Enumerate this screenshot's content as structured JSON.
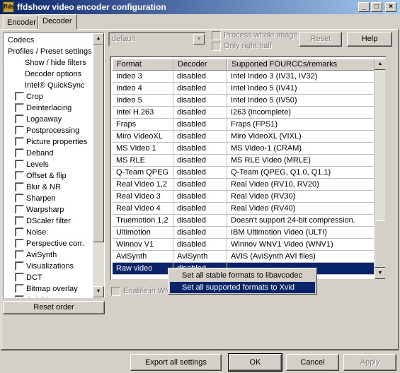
{
  "window": {
    "title": "ffdshow video encoder configuration",
    "min": "_",
    "max": "□",
    "close": "×",
    "app_icon": "ffds"
  },
  "tabs": [
    "Encoder",
    "Decoder"
  ],
  "tree": {
    "items": [
      {
        "label": "Codecs",
        "check": false,
        "indent": 0
      },
      {
        "label": "Profiles / Preset settings",
        "check": false,
        "indent": 0
      },
      {
        "label": "Show / hide filters",
        "check": false,
        "indent": 1
      },
      {
        "label": "Decoder options",
        "check": false,
        "indent": 1
      },
      {
        "label": "Intel® QuickSync",
        "check": false,
        "indent": 1
      },
      {
        "label": "Crop",
        "check": true
      },
      {
        "label": "Deinterlacing",
        "check": true
      },
      {
        "label": "Logoaway",
        "check": true
      },
      {
        "label": "Postprocessing",
        "check": true
      },
      {
        "label": "Picture properties",
        "check": true
      },
      {
        "label": "Deband",
        "check": true
      },
      {
        "label": "Levels",
        "check": true
      },
      {
        "label": "Offset & flip",
        "check": true
      },
      {
        "label": "Blur & NR",
        "check": true
      },
      {
        "label": "Sharpen",
        "check": true
      },
      {
        "label": "Warpsharp",
        "check": true
      },
      {
        "label": "DScaler filter",
        "check": true
      },
      {
        "label": "Noise",
        "check": true
      },
      {
        "label": "Perspective corr.",
        "check": true
      },
      {
        "label": "AviSynth",
        "check": true
      },
      {
        "label": "Visualizations",
        "check": true
      },
      {
        "label": "DCT",
        "check": true
      },
      {
        "label": "Bitmap overlay",
        "check": true
      },
      {
        "label": "Subtitles",
        "check": true
      }
    ]
  },
  "reset_order": "Reset order",
  "preset": {
    "value": "default",
    "process_whole": "Process whole image",
    "only_right": "Only right half",
    "reset": "Reset",
    "help": "Help"
  },
  "table": {
    "headers": [
      "Format",
      "Decoder",
      "Supported FOURCCs/remarks"
    ],
    "rows": [
      [
        "Indeo 3",
        "disabled",
        "Intel Indeo 3 (IV31, IV32)"
      ],
      [
        "Indeo 4",
        "disabled",
        "Intel Indeo 5 (IV41)"
      ],
      [
        "Indeo 5",
        "disabled",
        "Intel Indeo 5 (IV50)"
      ],
      [
        "Intel H.263",
        "disabled",
        "I263 (incomplete)"
      ],
      [
        "Fraps",
        "disabled",
        "Fraps (FPS1)"
      ],
      [
        "Miro VideoXL",
        "disabled",
        "Miro VideoXL (VIXL)"
      ],
      [
        "MS Video 1",
        "disabled",
        "MS Video-1 (CRAM)"
      ],
      [
        "MS RLE",
        "disabled",
        "MS RLE Video (MRLE)"
      ],
      [
        "Q-Team QPEG",
        "disabled",
        "Q-Team (QPEG, Q1.0, Q1.1)"
      ],
      [
        "Real Video 1,2",
        "disabled",
        "Real Video (RV10, RV20)"
      ],
      [
        "Real Video 3",
        "disabled",
        "Real Video (RV30)"
      ],
      [
        "Real Video 4",
        "disabled",
        "Real Video (RV40)"
      ],
      [
        "Truemotion 1,2",
        "disabled",
        "Doesn't support 24-bit compression."
      ],
      [
        "Ultimotion",
        "disabled",
        "IBM Ultimotion Video (ULTI)"
      ],
      [
        "Winnov V1",
        "disabled",
        "Winnov WNV1 Video (WNV1)"
      ],
      [
        "AviSynth",
        "AviSynth",
        "AVIS (AviSynth AVI files)"
      ],
      [
        "Raw video",
        "disabled",
        ""
      ]
    ],
    "selected_row": 16
  },
  "context_menu": [
    "Set all stable formats to libavcodec",
    "Set all supported formats to Xvid"
  ],
  "enable_in_wm": "Enable in WM",
  "footer": {
    "export": "Export all settings",
    "ok": "OK",
    "cancel": "Cancel",
    "apply": "Apply"
  },
  "colors": {
    "selection": "#0a246a",
    "face": "#d4d0c8"
  }
}
